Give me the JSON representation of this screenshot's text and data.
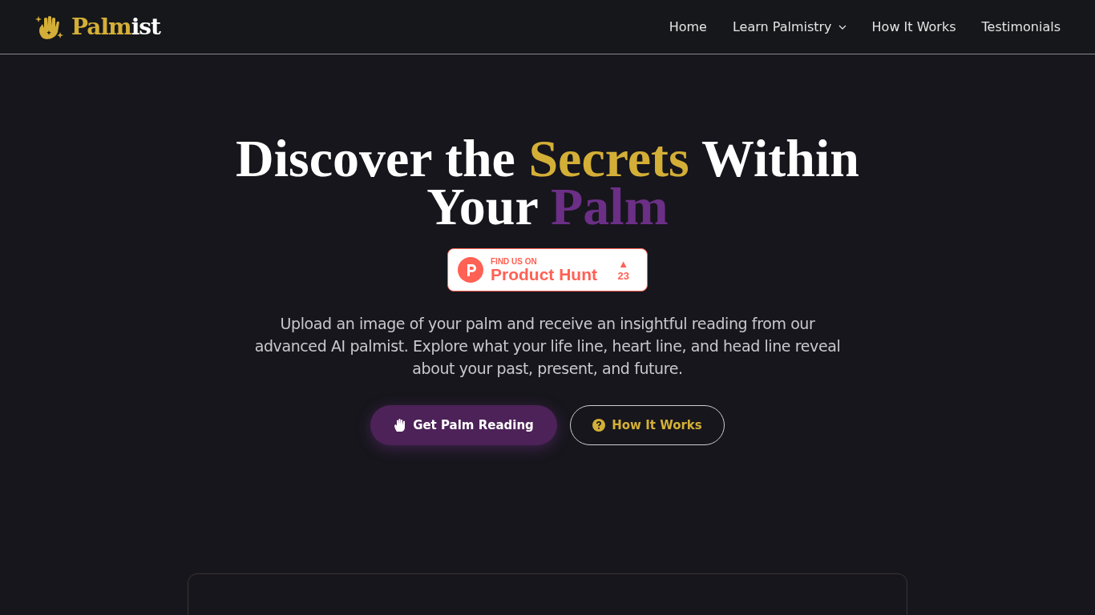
{
  "logo": {
    "parts": [
      {
        "text": "Palm",
        "color": "#d4af37"
      },
      {
        "text": "ist",
        "color": "#ffffff"
      }
    ]
  },
  "nav": [
    {
      "label": "Home",
      "dropdown": false
    },
    {
      "label": "Learn Palmistry",
      "dropdown": true
    },
    {
      "label": "How It Works",
      "dropdown": false
    },
    {
      "label": "Testimonials",
      "dropdown": false
    }
  ],
  "hero": {
    "title_lines": [
      [
        {
          "text": "Discover the ",
          "color": "#ffffff"
        },
        {
          "text": "Secrets",
          "color": "#d4af37"
        },
        {
          "text": " Within",
          "color": "#ffffff"
        }
      ],
      [
        {
          "text": "Your ",
          "color": "#ffffff"
        },
        {
          "text": "Palm",
          "color": "#6b2f86"
        }
      ]
    ],
    "badge": {
      "caption": "FIND US ON",
      "name": "Product Hunt",
      "arrow": "▲",
      "votes": "23"
    },
    "description": "Upload an image of your palm and receive an insightful reading from our advanced AI palmist. Explore what your life line, heart line, and head line reveal about your past, present, and future.",
    "buttons": [
      {
        "label": "Get Palm Reading",
        "kind": "primary"
      },
      {
        "label": "How It Works",
        "kind": "outline"
      }
    ]
  }
}
